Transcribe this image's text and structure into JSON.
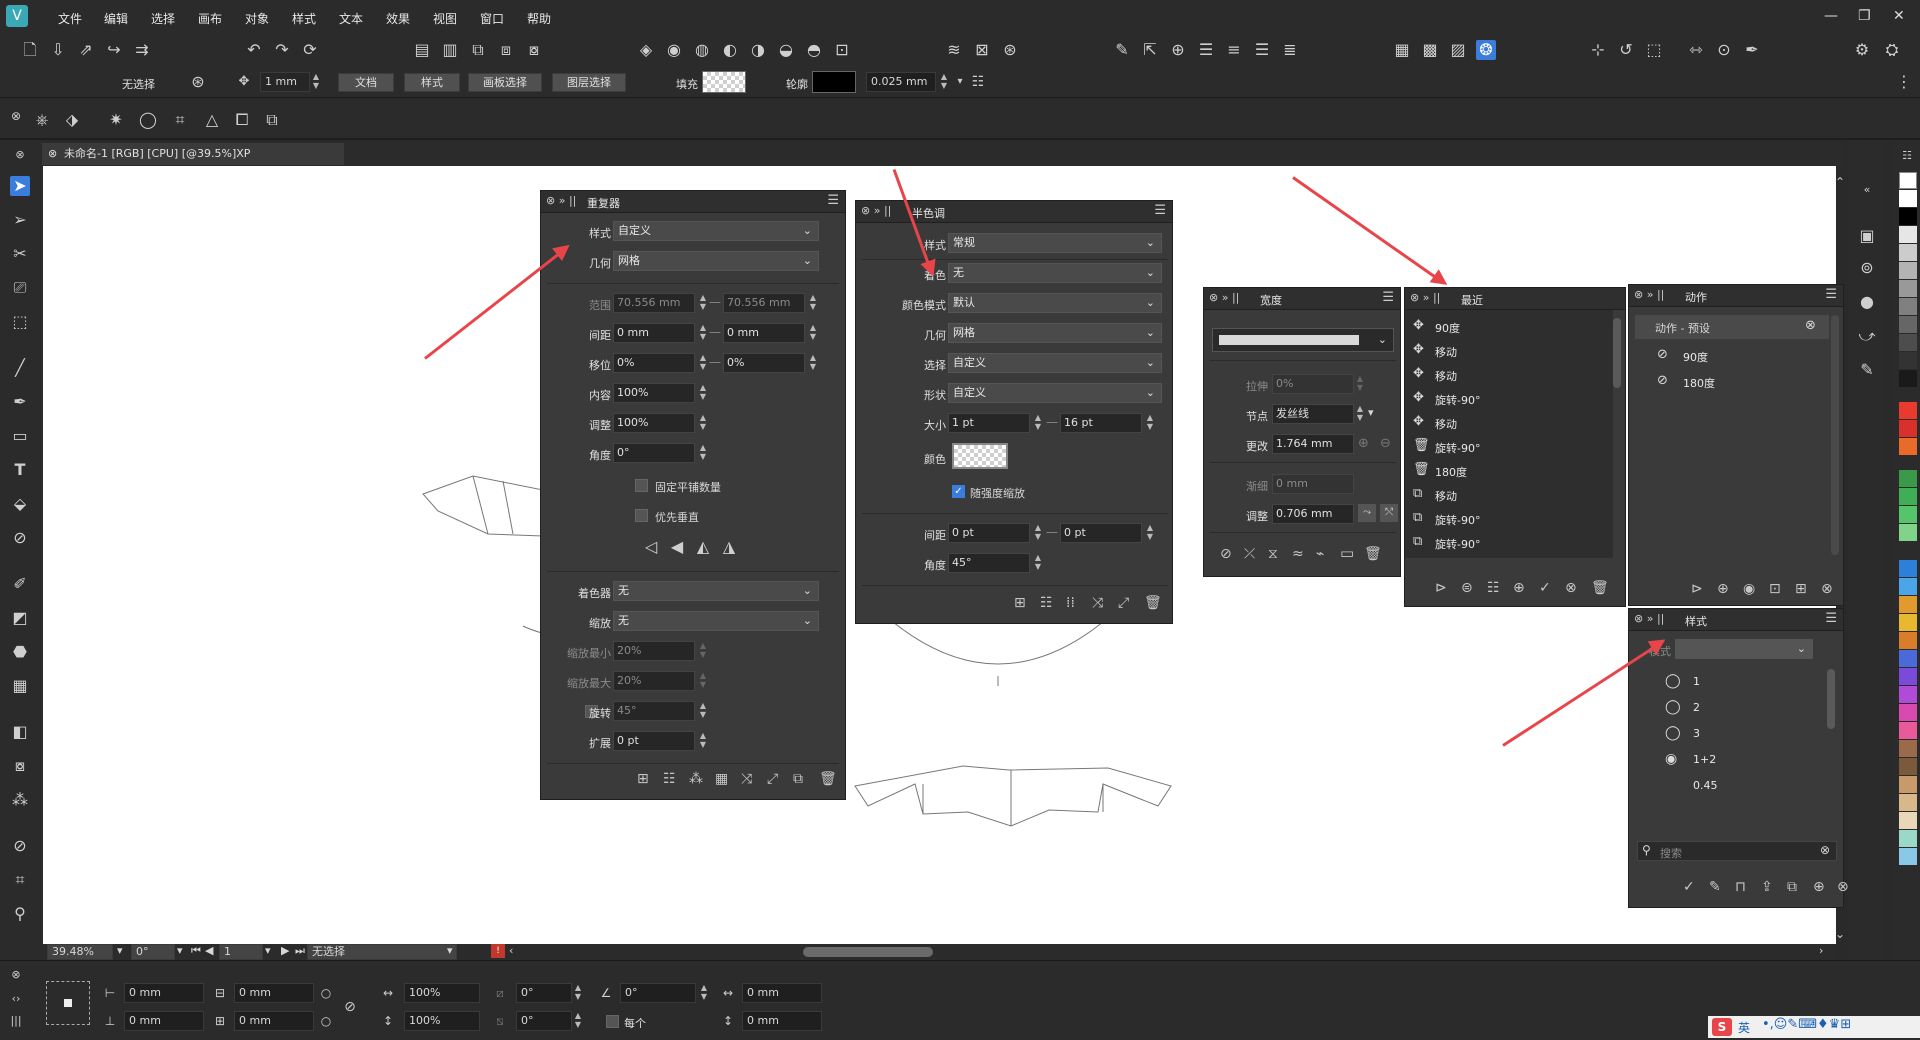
{
  "menu": [
    "文件",
    "编辑",
    "选择",
    "画布",
    "对象",
    "样式",
    "文本",
    "效果",
    "视图",
    "窗口",
    "帮助"
  ],
  "toolbar": {
    "no_select": "无选择",
    "nudge": "1 mm",
    "btn_doc": "文档",
    "btn_style": "样式",
    "btn_artboard": "画板选择",
    "btn_layer": "图层选择",
    "fill_label": "填充",
    "outline_label": "轮廓",
    "outline_width": "0.025 mm"
  },
  "doc_tab": "未命名-1 [RGB] [CPU] [@39.5%]XP",
  "repeater": {
    "title": "重复器",
    "style_label": "样式",
    "style_value": "自定义",
    "geometry_label": "几何",
    "geometry_value": "网格",
    "range_label": "范围",
    "range_a": "70.556 mm",
    "range_b": "70.556 mm",
    "spacing_label": "间距",
    "spacing_a": "0 mm",
    "spacing_b": "0 mm",
    "shift_label": "移位",
    "shift_a": "0%",
    "shift_b": "0%",
    "content_label": "内容",
    "content_value": "100%",
    "adjust_label": "调整",
    "adjust_value": "100%",
    "angle_label": "角度",
    "angle_value": "0°",
    "fixed_tiles": "固定平铺数量",
    "prefer_vertical": "优先垂直",
    "tint_label": "着色器",
    "tint_value": "无",
    "scale_label": "缩放",
    "scale_value": "无",
    "scale_min_label": "缩放最小",
    "scale_min_value": "20%",
    "scale_max_label": "缩放最大",
    "scale_max_value": "20%",
    "rotate_label": "旋转",
    "rotate_value": "45°",
    "expand_label": "扩展",
    "expand_value": "0 pt"
  },
  "halftone": {
    "title": "半色调",
    "style_label": "样式",
    "style_value": "常规",
    "tint_label": "着色",
    "tint_value": "无",
    "colormode_label": "颜色模式",
    "colormode_value": "默认",
    "geometry_label": "几何",
    "geometry_value": "网格",
    "select_label": "选择",
    "select_value": "自定义",
    "shape_label": "形状",
    "shape_value": "自定义",
    "size_label": "大小",
    "size_a": "1 pt",
    "size_b": "16 pt",
    "color_label": "颜色",
    "scale_with_intensity": "随强度缩放",
    "spacing_label": "间距",
    "spacing_a": "0 pt",
    "spacing_b": "0 pt",
    "angle_label": "角度",
    "angle_value": "45°"
  },
  "width_panel": {
    "title": "宽度",
    "stretch_label": "拉伸",
    "stretch_value": "0%",
    "node_label": "节点",
    "node_value": "发丝线",
    "change_label": "更改",
    "change_value": "1.764 mm",
    "taper_label": "渐细",
    "taper_value": "0 mm",
    "adjust_label": "调整",
    "adjust_value": "0.706 mm"
  },
  "recent": {
    "title": "最近",
    "items": [
      "90度",
      "移动",
      "移动",
      "旋转-90°",
      "移动",
      "旋转-90°",
      "180度",
      "移动",
      "旋转-90°",
      "旋转-90°"
    ]
  },
  "actions": {
    "title": "动作",
    "group": "动作 - 预设",
    "items": [
      "90度",
      "180度"
    ]
  },
  "styles": {
    "title": "样式",
    "mode_label": "模式",
    "items": [
      "1",
      "2",
      "3",
      "1+2",
      "0.45"
    ],
    "search_placeholder": "搜索"
  },
  "hscroll": {
    "zoom": "39.48%",
    "angle": "0°",
    "page": "1",
    "selection": "无选择"
  },
  "statusbar": {
    "x": "0 mm",
    "y": "0 mm",
    "w": "0 mm",
    "h": "0 mm",
    "sx": "100%",
    "sy": "100%",
    "rot": "0°",
    "rot2": "0°",
    "skew": "0°",
    "each_label": "每个",
    "offset1": "0 mm",
    "offset2": "0 mm"
  },
  "tray": {
    "ime": "英"
  },
  "colors": {
    "accent": "#3aa9b5",
    "arrow": "#e8454a"
  }
}
